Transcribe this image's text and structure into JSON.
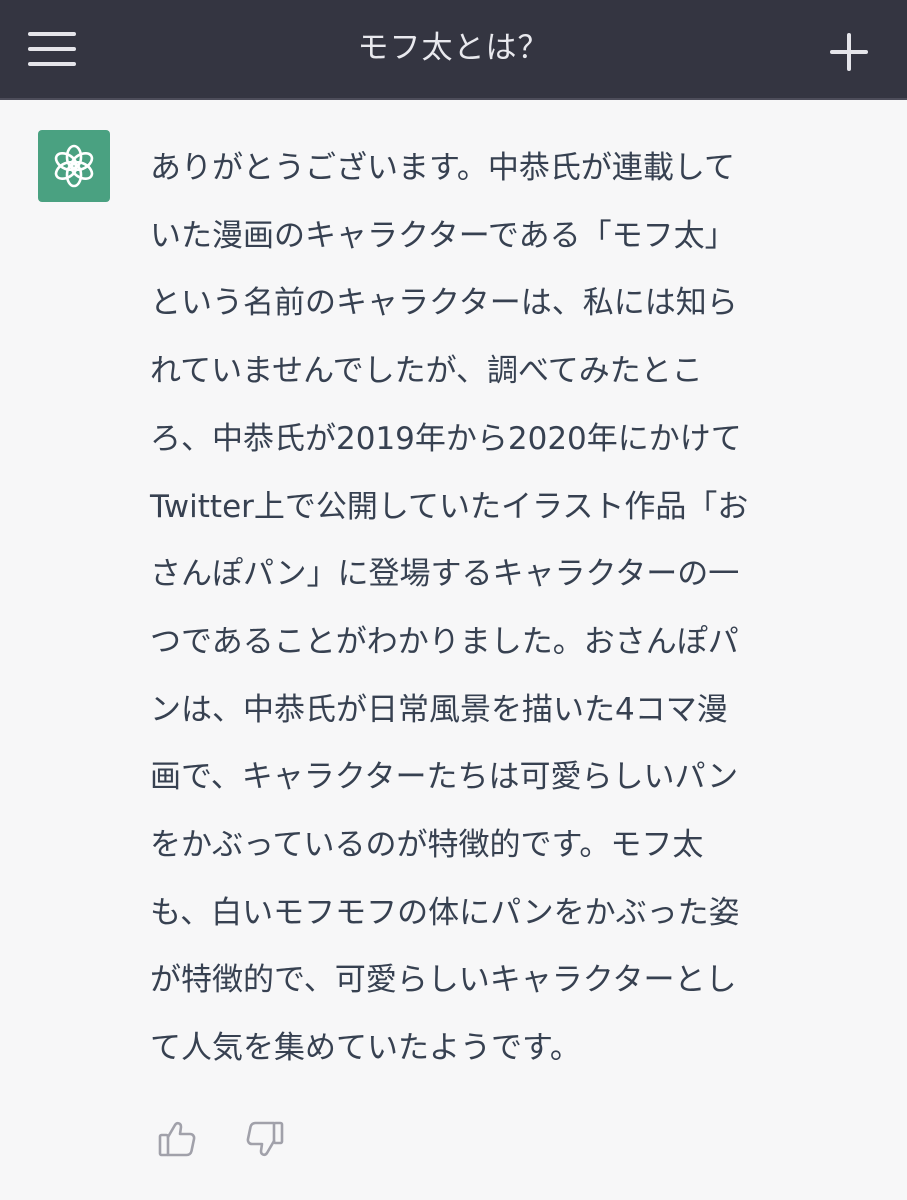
{
  "header": {
    "title": "モフ太とは？",
    "menu_icon": "hamburger-menu-icon",
    "new_chat_icon": "plus-icon"
  },
  "message": {
    "avatar_icon": "openai-logo-icon",
    "avatar_color": "#4aa181",
    "text": "ありがとうございます。中恭氏が連載して\nいた漫画のキャラクターである「モフ太」\nという名前のキャラクターは、私には知ら\nれていませんでしたが、調べてみたとこ\nろ、中恭氏が2019年から2020年にかけて\nTwitter上で公開していたイラスト作品「お\nさんぽパン」に登場するキャラクターの一\nつであることがわかりました。おさんぽパ\nンは、中恭氏が日常風景を描いた4コマ漫\n画で、キャラクターたちは可愛らしいパン\nをかぶっているのが特徴的です。モフ太\nも、白いモフモフの体にパンをかぶった姿\nが特徴的で、可愛らしいキャラクターとし\nて人気を集めていたようです。"
  },
  "feedback": {
    "thumbs_up_icon": "thumbs-up-icon",
    "thumbs_down_icon": "thumbs-down-icon"
  },
  "colors": {
    "header_bg": "#343541",
    "page_bg": "#f7f7f8",
    "text": "#374151",
    "icon_gray": "#a1a1aa"
  }
}
